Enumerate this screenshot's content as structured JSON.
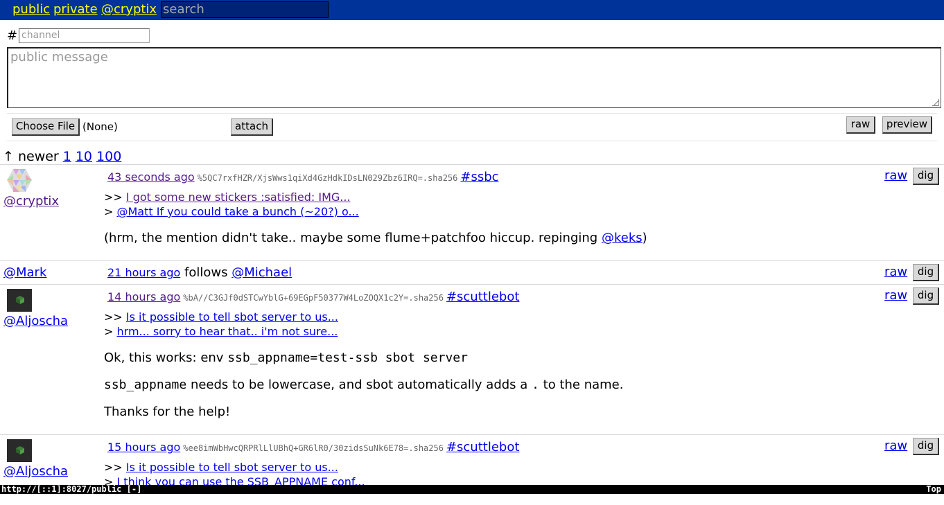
{
  "nav": {
    "public": "public",
    "private": "private",
    "self": "@cryptix",
    "search_placeholder": "search"
  },
  "compose": {
    "hash": "#",
    "channel_placeholder": "channel",
    "message_placeholder": "public message",
    "choose_file": "Choose File",
    "file_status": "(None)",
    "attach": "attach",
    "raw": "raw",
    "preview": "preview"
  },
  "pager": {
    "arrow_text": "↑ newer",
    "links": [
      "1",
      "10",
      "100"
    ]
  },
  "messages": [
    {
      "author": "@cryptix",
      "time": "43 seconds ago",
      "id": "%5QC7rxfHZR/XjsWws1qiXd4GzHdkIDsLN029Zbz6IRQ=.sha256",
      "channel": "#ssbc",
      "quote1_prefix": ">>",
      "quote1": "I got some new stickers :satisfied: IMG...",
      "quote2_prefix": ">",
      "quote2": "@Matt If you could take a bunch (~20?) o...",
      "body": "(hrm, the mention didn't take.. maybe some flume+patchfoo hiccup. repinging",
      "mention": "@keks",
      "body_end": ")",
      "raw": "raw",
      "dig": "dig"
    },
    {
      "author": "@Mark",
      "time": "21 hours ago",
      "verb": "follows",
      "target": "@Michael",
      "raw": "raw",
      "dig": "dig"
    },
    {
      "author": "@Aljoscha",
      "time": "14 hours ago",
      "id": "%bA//C3GJf0dSTCwYblG+69EGpF50377W4LoZOQX1c2Y=.sha256",
      "channel": "#scuttlebot",
      "quote1_prefix": ">>",
      "quote1": "Is it possible to tell sbot server to us...",
      "quote2_prefix": ">",
      "quote2": "hrm... sorry to hear that.. i'm not sure...",
      "line1_text": "Ok, this works: env",
      "line1_code": "ssb_appname=test-ssb sbot server",
      "line2_code": "ssb_appname",
      "line2_text": "needs to be lowercase, and sbot automatically adds a",
      "line2_code2": ".",
      "line2_text2": "to the name.",
      "line3": "Thanks for the help!",
      "raw": "raw",
      "dig": "dig"
    },
    {
      "author": "@Aljoscha",
      "time": "15 hours ago",
      "id": "%ee8imWbHwcQRPRlLlUBhQ+GR6lR0/30zidsSuNk6E78=.sha256",
      "channel": "#scuttlebot",
      "quote1_prefix": ">>",
      "quote1": "Is it possible to tell sbot server to us...",
      "quote2_prefix": ">",
      "quote2": "I think you can use the SSB_APPNAME conf...",
      "raw": "raw",
      "dig": "dig"
    }
  ],
  "status": {
    "url": "http://[::1]:8027/public [-]",
    "position": "Top"
  },
  "colors": {
    "navbar": "#003399",
    "nav_link": "#ffff00",
    "link": "#0000ee",
    "visited": "#551a8b",
    "statusbar": "#000000"
  }
}
